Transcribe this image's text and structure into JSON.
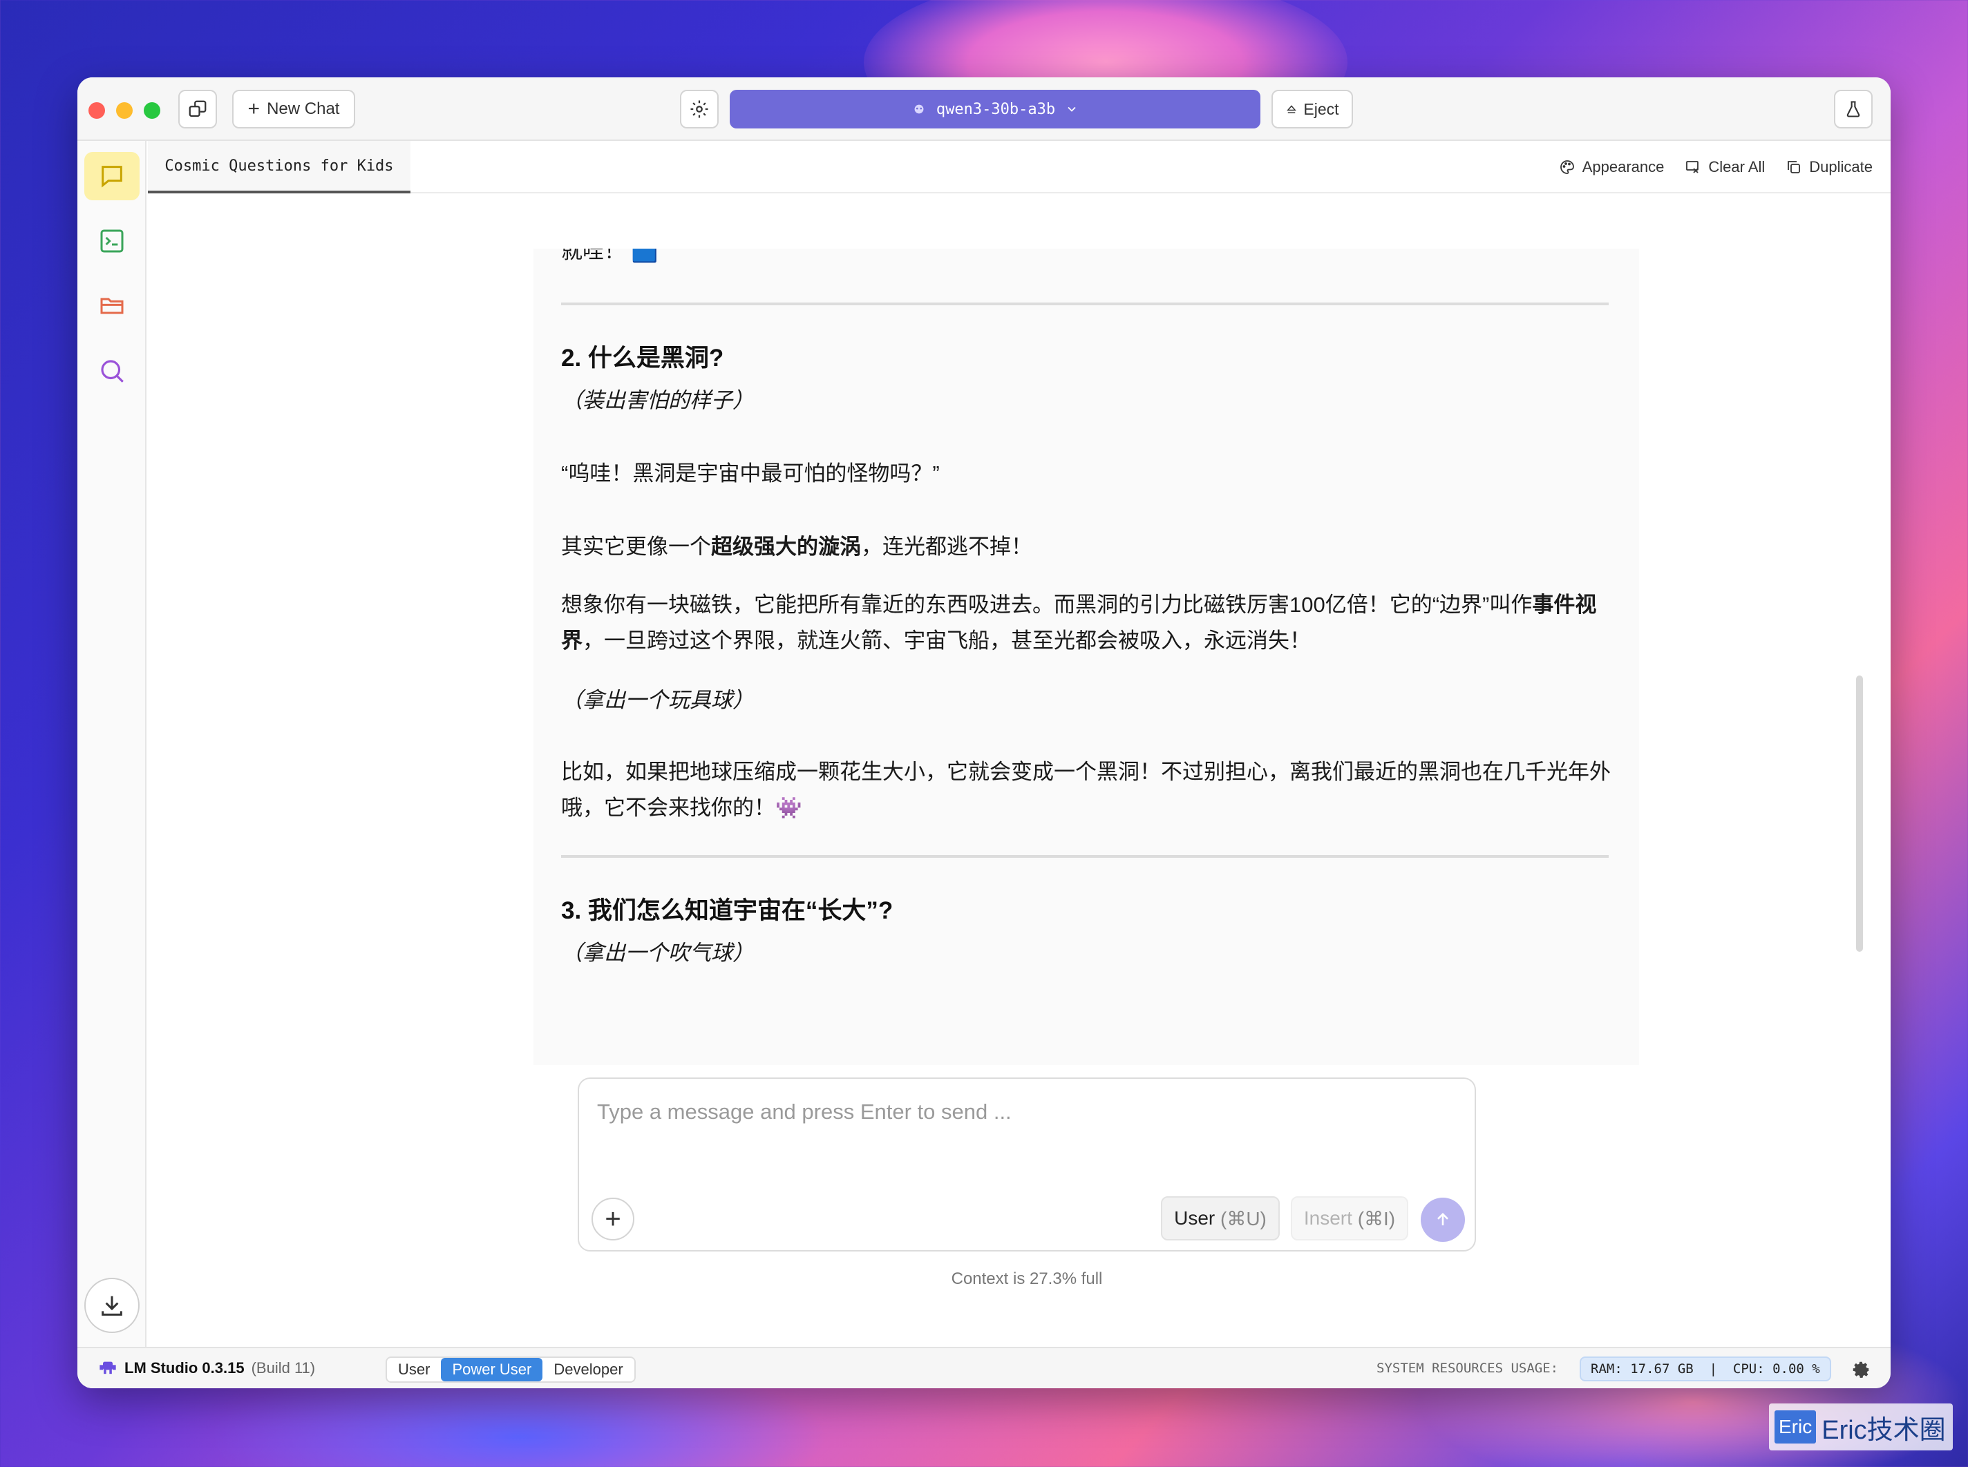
{
  "titlebar": {
    "new_chat_label": "New Chat",
    "model_name": "qwen3-30b-a3b",
    "eject_label": "Eject"
  },
  "tab": {
    "title": "Cosmic Questions for Kids"
  },
  "tab_actions": {
    "appearance": "Appearance",
    "clear_all": "Clear All",
    "duplicate": "Duplicate"
  },
  "message": {
    "partial_top": "就哇！ 🟦",
    "section2_heading": "2. 什么是黑洞?",
    "s2_stage1": "（装出害怕的样子）",
    "s2_quote": "“呜哇！黑洞是宇宙中最可怕的怪物吗？”",
    "s2_p1_a": "其实它更像一个",
    "s2_p1_bold": "超级强大的漩涡",
    "s2_p1_b": "，连光都逃不掉！",
    "s2_p2_a": "想象你有一块磁铁，它能把所有靠近的东西吸进去。而黑洞的引力比磁铁厉害100亿倍！它的“边界”叫作",
    "s2_p2_bold": "事件视界",
    "s2_p2_b": "，一旦跨过这个界限，就连火箭、宇宙飞船，甚至光都会被吸入，永远消失！",
    "s2_stage2": "（拿出一个玩具球）",
    "s2_p3": "比如，如果把地球压缩成一颗花生大小，它就会变成一个黑洞！不过别担心，离我们最近的黑洞也在几千光年外哦，它不会来找你的！👾",
    "section3_heading": "3. 我们怎么知道宇宙在“长大”?",
    "s3_stage1": "（拿出一个吹气球）"
  },
  "input": {
    "placeholder": "Type a message and press Enter to send ...",
    "user_label": "User",
    "user_shortcut": "(⌘U)",
    "insert_label": "Insert",
    "insert_shortcut": "(⌘I)",
    "context_text": "Context is 27.3% full"
  },
  "statusbar": {
    "app_name": "LM Studio 0.3.15",
    "build": "(Build 11)",
    "modes": [
      "User",
      "Power User",
      "Developer"
    ],
    "active_mode": "Power User",
    "sys_label": "SYSTEM RESOURCES USAGE:",
    "sys_value": "RAM: 17.67 GB  |  CPU: 0.00 %"
  },
  "watermark": {
    "tag": "Eric",
    "text": "Eric技术圈"
  },
  "colors": {
    "model_button": "#6f6ad8",
    "active_mode": "#3a86e0",
    "chat_icon_bg": "#fdf1a8"
  }
}
